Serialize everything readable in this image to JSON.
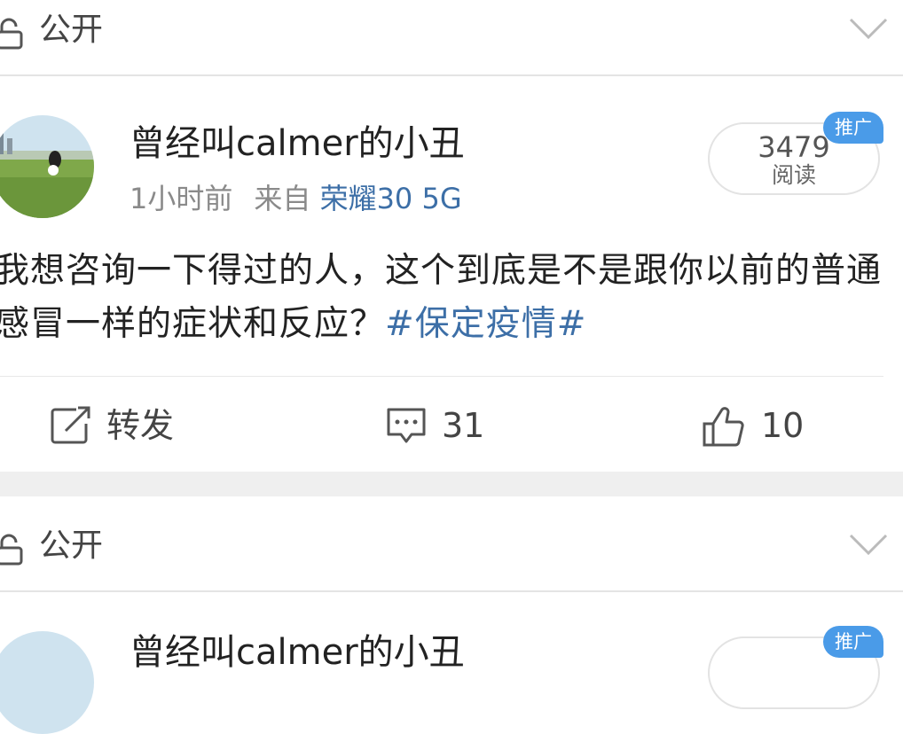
{
  "post": {
    "privacy_label": "公开",
    "username": "曾经叫calmer的小丑",
    "time": "1小时前",
    "from_label": "来自",
    "device": "荣耀30 5G",
    "read_count": "3479",
    "read_unit": "阅读",
    "promo_badge": "推广",
    "text_main": "我想咨询一下得过的人，这个到底是不是跟你以前的普通感冒一样的症状和反应？",
    "hashtag": "#保定疫情#",
    "repost_label": "转发",
    "comment_count": "31",
    "like_count": "10"
  },
  "next_post": {
    "privacy_label": "公开",
    "username": "曾经叫calmer的小丑",
    "promo_badge": "推广"
  },
  "colors": {
    "link": "#3d6fa7",
    "badge": "#4a9be8",
    "muted": "#8a8a8a"
  },
  "icons": [
    "lock-open-icon",
    "chevron-down-icon",
    "repost-icon",
    "comment-icon",
    "like-icon"
  ]
}
